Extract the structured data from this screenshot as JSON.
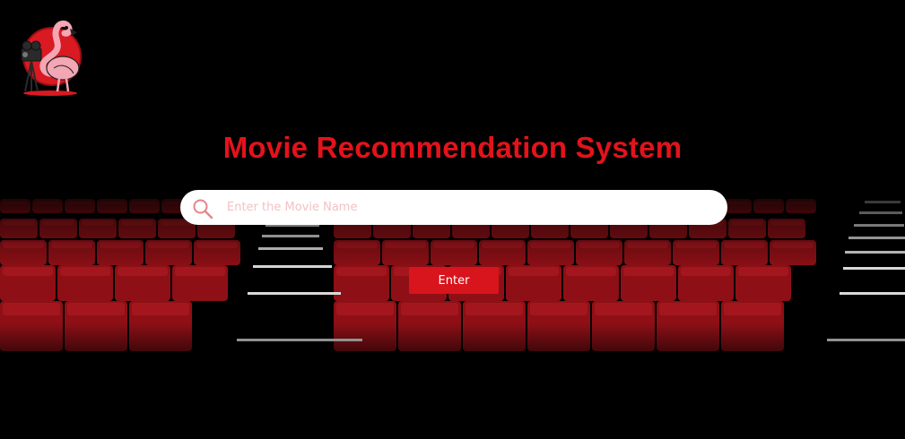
{
  "logo": {
    "icon": "flamingo-camera-logo-icon",
    "brand_color": "#e3131b"
  },
  "header": {
    "title": "Movie Recommendation System"
  },
  "search": {
    "placeholder": "Enter the Movie Name",
    "value": "",
    "icon": "search-icon"
  },
  "actions": {
    "enter_label": "Enter"
  },
  "colors": {
    "accent": "#e3131b",
    "background": "#000000",
    "seat": "#8e1016",
    "button": "#d8141d"
  }
}
